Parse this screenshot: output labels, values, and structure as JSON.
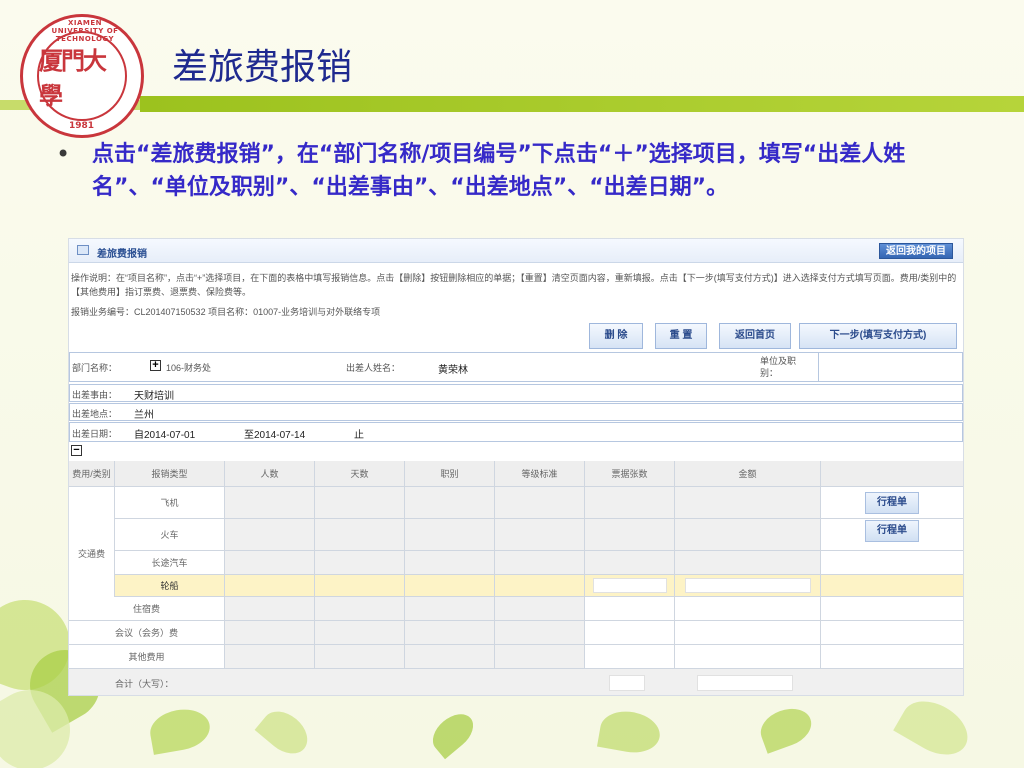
{
  "slide": {
    "title": "差旅费报销",
    "bullet_symbol": "•",
    "bullet_text": "点击“差旅费报销”，在“部门名称/项目编号”下点击“＋”选择项目，填写“出差人姓名”、“单位及职别”、“出差事由”、“出差地点”、“出差日期”。",
    "logo": {
      "center_text": "厦門大學",
      "ring_text": "XIAMEN UNIVERSITY OF TECHNOLOGY",
      "year": "1981"
    }
  },
  "app": {
    "title": "差旅费报销",
    "return_project_button": "返回我的项目",
    "instructions": "操作说明：在“项目名称”，点击“+”选择项目，在下面的表格中填写报销信息。点击【删除】按钮删除相应的单据；【重置】清空页面内容，重新填报。点击【下一步(填写支付方式)】进入选择支付方式填写页面。费用/类别中的【其他费用】指订票费、退票费、保险费等。",
    "order_info": "报销业务编号：CL201407150532   项目名称：01007-业务培训与对外联络专项",
    "buttons": {
      "delete": "删 除",
      "reset": "重 置",
      "home": "返回首页",
      "next": "下一步(填写支付方式)"
    },
    "form": {
      "dept_label": "部门名称：",
      "dept_value": "106-财务处",
      "traveler_label": "出差人姓名：",
      "traveler_value": "黄荣林",
      "position_label": "单位及职别：",
      "position_value": "",
      "reason_label": "出差事由：",
      "reason_value": "天财培训",
      "place_label": "出差地点：",
      "place_value": "兰州",
      "date_label": "出差日期：",
      "date_from": "自2014-07-01",
      "date_to": "至2014-07-14",
      "date_end": "止"
    },
    "grid": {
      "headers": [
        "费用/类别",
        "报销类型",
        "人数",
        "天数",
        "职别",
        "等级标准",
        "票据张数",
        "金额"
      ],
      "transport_label": "交通费",
      "transport_rows": [
        "飞机",
        "火车",
        "长途汽车",
        "轮船"
      ],
      "other_rows": [
        "住宿费",
        "会议（会务）费",
        "其他费用"
      ],
      "total_label": "合计（大写）：",
      "itinerary_button": "行程单"
    }
  }
}
